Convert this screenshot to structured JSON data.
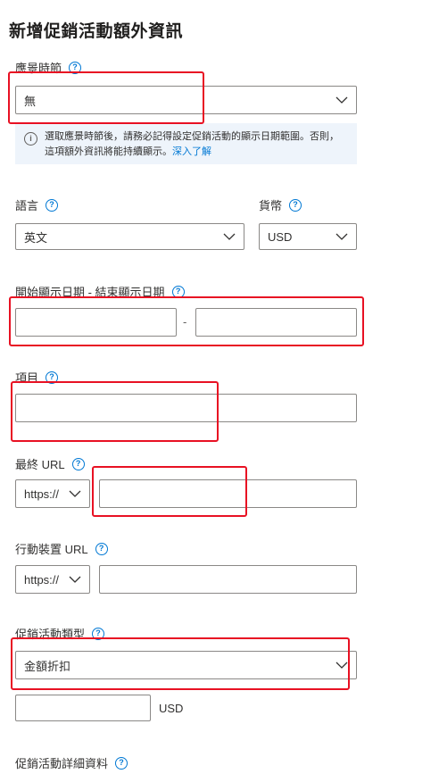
{
  "title": "新增促銷活動額外資訊",
  "occasion": {
    "label": "應景時節",
    "value": "無",
    "info_text": "選取應景時節後，請務必記得設定促銷活動的顯示日期範圍。否則，這項額外資訊將能持續顯示。",
    "info_link": "深入了解"
  },
  "language": {
    "label": "語言",
    "value": "英文"
  },
  "currency": {
    "label": "貨幣",
    "value": "USD"
  },
  "display_dates": {
    "label": "開始顯示日期 - 結束顯示日期",
    "separator": "-",
    "start_value": "",
    "end_value": ""
  },
  "item": {
    "label": "項目",
    "value": ""
  },
  "final_url": {
    "label": "最終 URL",
    "protocol": "https://",
    "value": ""
  },
  "mobile_url": {
    "label": "行動裝置 URL",
    "protocol": "https://",
    "value": ""
  },
  "promotion_type": {
    "label": "促銷活動類型",
    "value": "金額折扣",
    "amount_value": "",
    "amount_unit": "USD"
  },
  "promotion_details": {
    "label": "促銷活動詳細資料"
  },
  "help_glyph": "?",
  "info_glyph": "i",
  "colors": {
    "accent": "#0078d4",
    "highlight": "#e81123",
    "info_bg": "#eef4fb",
    "border": "#8a8886"
  }
}
